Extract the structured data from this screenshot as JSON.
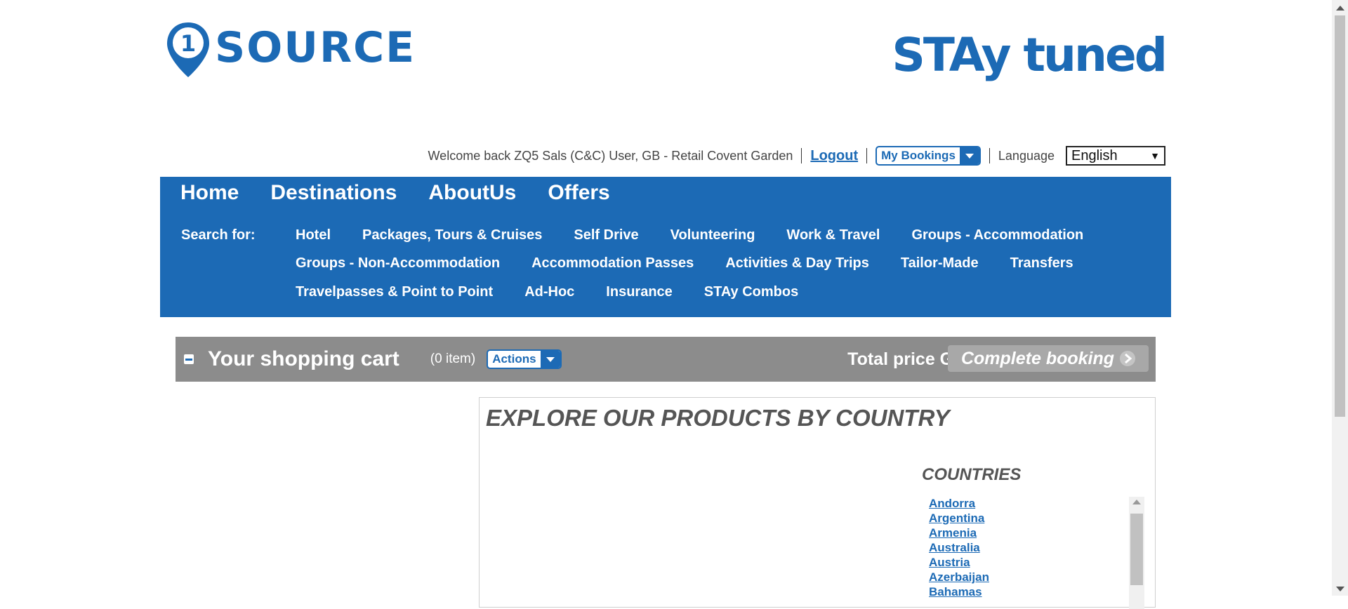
{
  "brand": {
    "left_logo_text": "SOURCE",
    "left_logo_number": "1",
    "right_logo_text": "STAy tuned",
    "color": "#1c6ab5"
  },
  "userbar": {
    "welcome": "Welcome back ZQ5 Sals (C&C) User, GB - Retail Covent Garden",
    "logout": "Logout",
    "my_bookings": "My Bookings",
    "language_label": "Language",
    "language_value": "English"
  },
  "nav": {
    "main": [
      "Home",
      "Destinations",
      "AboutUs",
      "Offers"
    ],
    "search_for": "Search for:",
    "row1": [
      "Hotel",
      "Packages, Tours & Cruises",
      "Self Drive",
      "Volunteering",
      "Work & Travel",
      "Groups - Accommodation"
    ],
    "row2": [
      "Groups - Non-Accommodation",
      "Accommodation Passes",
      "Activities & Day Trips",
      "Tailor-Made",
      "Transfers"
    ],
    "row3": [
      "Travelpasses & Point to Point",
      "Ad-Hoc",
      "Insurance",
      "STAy Combos"
    ]
  },
  "cart": {
    "title": "Your shopping cart",
    "count": "(0 item)",
    "actions": "Actions",
    "total": "Total price GBP 0.00",
    "complete": "Complete booking",
    "bar_color": "#8c8c8c"
  },
  "explore": {
    "title": "EXPLORE OUR PRODUCTS BY COUNTRY",
    "countries_title": "COUNTRIES",
    "countries": [
      "Andorra",
      "Argentina",
      "Armenia",
      "Australia",
      "Austria",
      "Azerbaijan",
      "Bahamas"
    ]
  }
}
